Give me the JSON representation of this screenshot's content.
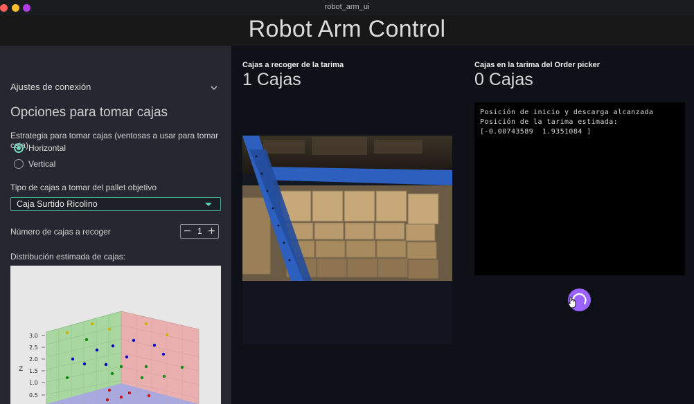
{
  "window": {
    "title": "robot_arm_ui"
  },
  "header": {
    "title": "Robot Arm Control"
  },
  "sidebar": {
    "connection_expander": "Ajustes de conexión",
    "section_title": "Opciones para tomar cajas",
    "strategy": {
      "label": "Estrategia para tomar cajas (ventosas a usar para tomar caja)",
      "options": [
        {
          "label": "Horizontal",
          "selected": true
        },
        {
          "label": "Vertical",
          "selected": false
        }
      ]
    },
    "box_type": {
      "label": "Tipo de cajas a tomar del pallet objetivo",
      "selected": "Caja Surtido Ricolino"
    },
    "count": {
      "label": "Número de cajas a recoger",
      "value": "1",
      "minus": "−",
      "plus": "+"
    },
    "distribution_label": "Distribución estimada de cajas:",
    "plot": {
      "z_axis_label": "Z",
      "z_ticks": [
        "3.0",
        "2.5",
        "2.0",
        "1.5",
        "1.0",
        "0.5"
      ]
    }
  },
  "main": {
    "pick": {
      "title": "Cajas a recoger de la tarima",
      "value": "1 Cajas"
    },
    "order": {
      "title": "Cajas en la tarima del Order picker",
      "value": "0 Cajas"
    },
    "log": [
      "Posición de inicio y descarga alcanzada",
      "Posición de la tarima estimada:",
      "[-0.00743589  1.9351084 ]"
    ]
  },
  "colors": {
    "accent": "#6fd6bf",
    "spinner": "#9b62ff",
    "rack_blue": "#2d5fbf",
    "box_tan": "#c7a878"
  }
}
